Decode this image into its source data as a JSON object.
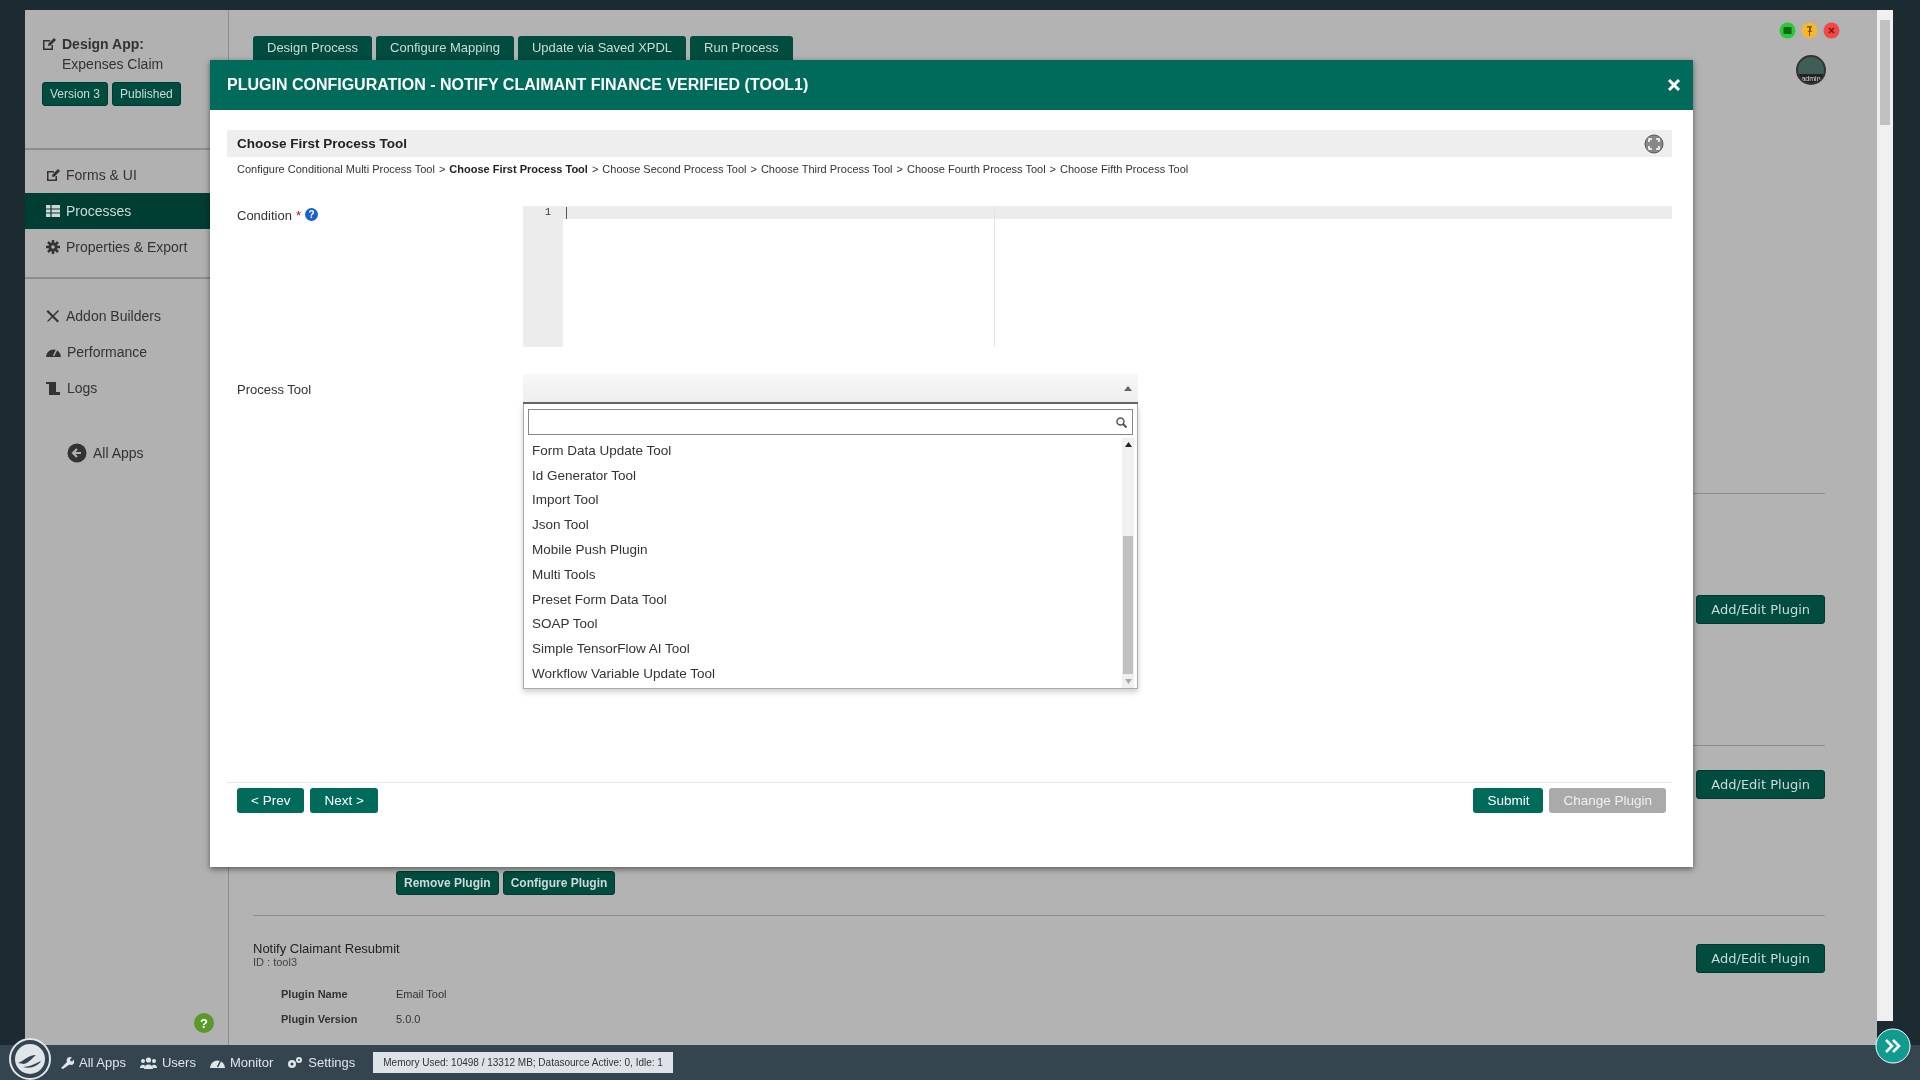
{
  "sidebar": {
    "heading": "Design App:",
    "app_name": "Expenses Claim",
    "badges": [
      "Version 3",
      "Published"
    ],
    "menu_groups": [
      [
        {
          "label": "Forms & UI",
          "selected": false
        },
        {
          "label": "Processes",
          "selected": true
        },
        {
          "label": "Properties & Export",
          "selected": false
        }
      ],
      [
        {
          "label": "Addon Builders",
          "selected": false
        },
        {
          "label": "Performance",
          "selected": false
        },
        {
          "label": "Logs",
          "selected": false
        }
      ]
    ],
    "back_link": "All Apps",
    "help_button": "?"
  },
  "user": {
    "name": "admin"
  },
  "process_tabs": [
    "Design Process",
    "Configure Mapping",
    "Update via Saved XPDL",
    "Run Process"
  ],
  "plugin_rows": [
    {
      "add_button": "Add/Edit Plugin"
    },
    {
      "add_button": "Add/Edit Plugin",
      "actions": [
        "Remove Plugin",
        "Configure Plugin"
      ]
    },
    {
      "name": "Notify Claimant Resubmit",
      "id_text": "ID : tool3",
      "add_button": "Add/Edit Plugin",
      "details": [
        {
          "label": "Plugin Name",
          "value": "Email Tool"
        },
        {
          "label": "Plugin Version",
          "value": "5.0.0"
        }
      ]
    }
  ],
  "modal": {
    "title": "PLUGIN CONFIGURATION - NOTIFY CLAIMANT FINANCE VERIFIED (TOOL1)",
    "step_title": "Choose First Process Tool",
    "separator": ">",
    "steps": [
      {
        "label": "Configure Conditional Multi Process Tool",
        "selected": false
      },
      {
        "label": "Choose First Process Tool",
        "selected": true
      },
      {
        "label": "Choose Second Process Tool",
        "selected": false
      },
      {
        "label": "Choose Third Process Tool",
        "selected": false
      },
      {
        "label": "Choose Fourth Process Tool",
        "selected": false
      },
      {
        "label": "Choose Fifth Process Tool",
        "selected": false
      }
    ],
    "fields": [
      {
        "kind": "code",
        "label": "Condition",
        "required_mark": "*",
        "help": "?",
        "line_numbers": [
          "1"
        ]
      },
      {
        "kind": "select",
        "label": "Process Tool",
        "open": true,
        "options": [
          {
            "label": "Form Data Update Tool",
            "selected": false
          },
          {
            "label": "Id Generator Tool",
            "selected": false
          },
          {
            "label": "Import Tool",
            "selected": false
          },
          {
            "label": "Json Tool",
            "selected": false
          },
          {
            "label": "Mobile Push Plugin",
            "selected": false
          },
          {
            "label": "Multi Tools",
            "selected": false
          },
          {
            "label": "Preset Form Data Tool",
            "selected": false
          },
          {
            "label": "SOAP Tool",
            "selected": false
          },
          {
            "label": "Simple TensorFlow AI Tool",
            "selected": false
          },
          {
            "label": "Workflow Variable Update Tool",
            "selected": false
          }
        ]
      }
    ],
    "footer_left": [
      "< Prev",
      "Next >"
    ],
    "footer_right": [
      {
        "label": "Submit",
        "disabled": false
      },
      {
        "label": "Change Plugin",
        "disabled": true
      }
    ]
  },
  "taskbar": {
    "items": [
      "All Apps",
      "Users",
      "Monitor",
      "Settings"
    ],
    "status": "Memory Used: 10498 / 13312 MB; Datasource Active: 0, Idle: 1"
  }
}
